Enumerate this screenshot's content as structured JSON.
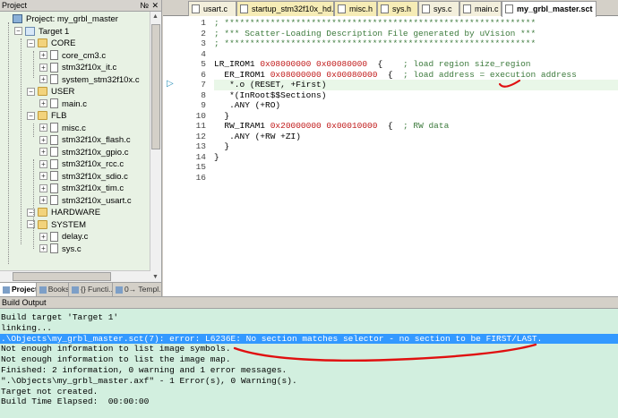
{
  "project": {
    "title": "Project",
    "pin_glyph": "№",
    "close_glyph": "✕",
    "tree": [
      {
        "label": "Project: my_grbl_master",
        "kind": "proj"
      },
      {
        "label": "Target 1",
        "kind": "target"
      },
      {
        "label": "CORE",
        "kind": "folder"
      },
      {
        "label": "core_cm3.c",
        "kind": "file"
      },
      {
        "label": "stm32f10x_it.c",
        "kind": "file"
      },
      {
        "label": "system_stm32f10x.c",
        "kind": "file"
      },
      {
        "label": "USER",
        "kind": "folder"
      },
      {
        "label": "main.c",
        "kind": "file"
      },
      {
        "label": "FLB",
        "kind": "folder"
      },
      {
        "label": "misc.c",
        "kind": "file"
      },
      {
        "label": "stm32f10x_flash.c",
        "kind": "file"
      },
      {
        "label": "stm32f10x_gpio.c",
        "kind": "file"
      },
      {
        "label": "stm32f10x_rcc.c",
        "kind": "file"
      },
      {
        "label": "stm32f10x_sdio.c",
        "kind": "file"
      },
      {
        "label": "stm32f10x_tim.c",
        "kind": "file"
      },
      {
        "label": "stm32f10x_usart.c",
        "kind": "file"
      },
      {
        "label": "HARDWARE",
        "kind": "folder"
      },
      {
        "label": "SYSTEM",
        "kind": "folder"
      },
      {
        "label": "delay.c",
        "kind": "file"
      },
      {
        "label": "sys.c",
        "kind": "file"
      }
    ],
    "tabs": [
      {
        "label": "Project",
        "active": true
      },
      {
        "label": "Books",
        "active": false
      },
      {
        "label": "{} Functi...",
        "active": false
      },
      {
        "label": "0→ Templ...",
        "active": false
      }
    ]
  },
  "editor": {
    "tabs": [
      {
        "label": "usart.c",
        "kind": "c"
      },
      {
        "label": "startup_stm32f10x_hd.s",
        "kind": "h"
      },
      {
        "label": "misc.h",
        "kind": "h"
      },
      {
        "label": "sys.h",
        "kind": "h"
      },
      {
        "label": "sys.c",
        "kind": "c"
      },
      {
        "label": "main.c",
        "kind": "c"
      },
      {
        "label": "my_grbl_master.sct",
        "kind": "sct",
        "active": true
      }
    ],
    "lines": [
      {
        "n": "1",
        "parts": [
          {
            "t": "; *************************************************************",
            "c": "com"
          }
        ]
      },
      {
        "n": "2",
        "parts": [
          {
            "t": "; *** Scatter-Loading Description File generated by uVision ***",
            "c": "com"
          }
        ]
      },
      {
        "n": "3",
        "parts": [
          {
            "t": "; *************************************************************",
            "c": "com"
          }
        ]
      },
      {
        "n": "4",
        "parts": []
      },
      {
        "n": "5",
        "parts": [
          {
            "t": "LR_IROM1 ",
            "c": ""
          },
          {
            "t": "0x08000000 0x00080000",
            "c": "red"
          },
          {
            "t": "  {    ",
            "c": ""
          },
          {
            "t": "; load region size_region",
            "c": "com"
          }
        ]
      },
      {
        "n": "6",
        "parts": [
          {
            "t": "  ER_IROM1 ",
            "c": ""
          },
          {
            "t": "0x08000000 0x00080000",
            "c": "red"
          },
          {
            "t": "  {  ",
            "c": ""
          },
          {
            "t": "; load address = execution address",
            "c": "com"
          }
        ]
      },
      {
        "n": "7",
        "parts": [
          {
            "t": "   *.o (RESET, +First)",
            "c": ""
          }
        ],
        "hl": true
      },
      {
        "n": "8",
        "parts": [
          {
            "t": "   *(InRoot$$Sections)",
            "c": ""
          }
        ]
      },
      {
        "n": "9",
        "parts": [
          {
            "t": "   .ANY (+RO)",
            "c": ""
          }
        ]
      },
      {
        "n": "10",
        "parts": [
          {
            "t": "  }",
            "c": ""
          }
        ]
      },
      {
        "n": "11",
        "parts": [
          {
            "t": "  RW_IRAM1 ",
            "c": ""
          },
          {
            "t": "0x20000000 0x00010000",
            "c": "red"
          },
          {
            "t": "  {  ",
            "c": ""
          },
          {
            "t": "; RW data",
            "c": "com"
          }
        ]
      },
      {
        "n": "12",
        "parts": [
          {
            "t": "   .ANY (+RW +ZI)",
            "c": ""
          }
        ]
      },
      {
        "n": "13",
        "parts": [
          {
            "t": "  }",
            "c": ""
          }
        ]
      },
      {
        "n": "14",
        "parts": [
          {
            "t": "}",
            "c": ""
          }
        ]
      },
      {
        "n": "15",
        "parts": []
      },
      {
        "n": "16",
        "parts": []
      }
    ],
    "current_line_marker": "▷"
  },
  "output": {
    "title": "Build Output",
    "lines": [
      {
        "text": "Build target 'Target 1'",
        "sel": false
      },
      {
        "text": "linking...",
        "sel": false
      },
      {
        "text": ".\\Objects\\my_grbl_master.sct(7): error: L6236E: No section matches selector - no section to be FIRST/LAST.",
        "sel": true
      },
      {
        "text": "Not enough information to list image symbols.",
        "sel": false
      },
      {
        "text": "Not enough information to list the image map.",
        "sel": false
      },
      {
        "text": "Finished: 2 information, 0 warning and 1 error messages.",
        "sel": false
      },
      {
        "text": "\".\\Objects\\my_grbl_master.axf\" - 1 Error(s), 0 Warning(s).",
        "sel": false
      },
      {
        "text": "Target not created.",
        "sel": false
      },
      {
        "text": "Build Time Elapsed:  00:00:00",
        "sel": false
      }
    ]
  },
  "colors": {
    "output_bg": "#d2efdf",
    "selection": "#3399ff",
    "annotation_red": "#e01010",
    "comment": "#3c7a3c",
    "hex_literal": "#c01a1a"
  }
}
